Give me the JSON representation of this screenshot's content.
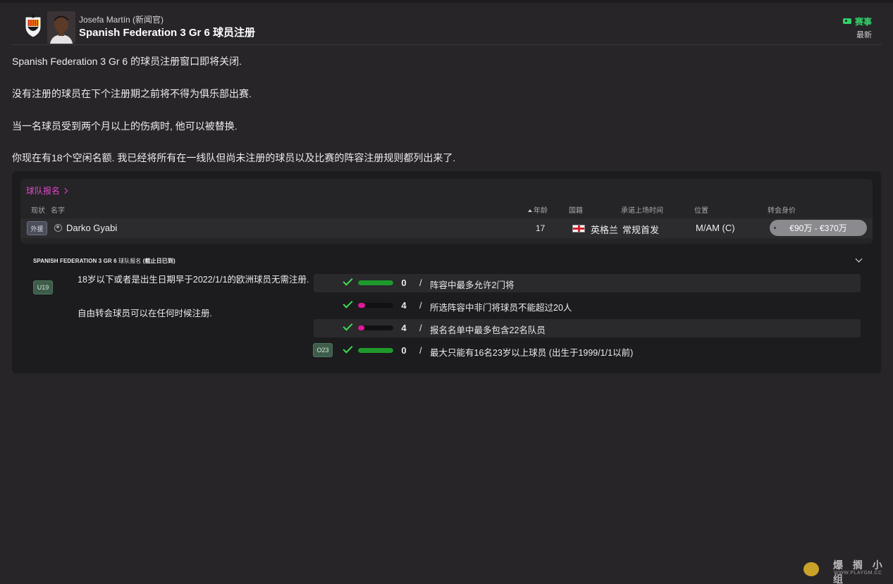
{
  "header": {
    "sender": "Josefa Martín (新闻官)",
    "subject": "Spanish Federation 3 Gr 6 球员注册",
    "tag_label": "赛事",
    "tag_sub": "最新"
  },
  "body": {
    "p1": "Spanish Federation 3 Gr 6 的球员注册窗口即将关闭.",
    "p2": "没有注册的球员在下个注册期之前将不得为俱乐部出赛.",
    "p3": "当一名球员受到两个月以上的伤病时, 他可以被替换.",
    "p4": "你现在有18个空闲名额. 我已经将所有在一线队但尚未注册的球员以及比赛的阵容注册规则都列出来了."
  },
  "team_registration": {
    "link_label": "球队报名",
    "columns": {
      "status": "现状",
      "name": "名字",
      "age": "年龄",
      "nationality": "国籍",
      "role": "承诺上场时间",
      "position": "位置",
      "value": "转会身价"
    },
    "players": [
      {
        "status": "外援",
        "name": "Darko Gyabi",
        "age": "17",
        "nationality": "英格兰",
        "role": "常规首发",
        "position": "M/AM (C)",
        "value": "€90万 - €370万"
      }
    ]
  },
  "rules": {
    "title": "SPANISH FEDERATION 3 GR 6",
    "title_tail": "球队报名",
    "title_paren": "(截止日已到)",
    "u19_badge": "U19",
    "note1": "18岁以下或者是出生日期早于2022/1/1的欧洲球员无需注册.",
    "note2": "自由转会球员可以在任何时候注册.",
    "items": [
      {
        "count": "0",
        "text": "阵容中最多允许2门将",
        "fill": 1.0,
        "color": "#1e9a2c",
        "badge": ""
      },
      {
        "count": "4",
        "text": "所选阵容中非门将球员不能超过20人",
        "fill": 0.2,
        "color": "#e0199a",
        "badge": ""
      },
      {
        "count": "4",
        "text": "报名名单中最多包含22名队员",
        "fill": 0.18,
        "color": "#e0199a",
        "badge": ""
      },
      {
        "count": "0",
        "text": "最大只能有16名23岁以上球员 (出生于1999/1/1以前)",
        "fill": 1.0,
        "color": "#1e9a2c",
        "badge": "O23"
      }
    ]
  },
  "watermark": {
    "text": "爆 搁 小 组",
    "url": "WWW.PLAYGM.CC"
  }
}
